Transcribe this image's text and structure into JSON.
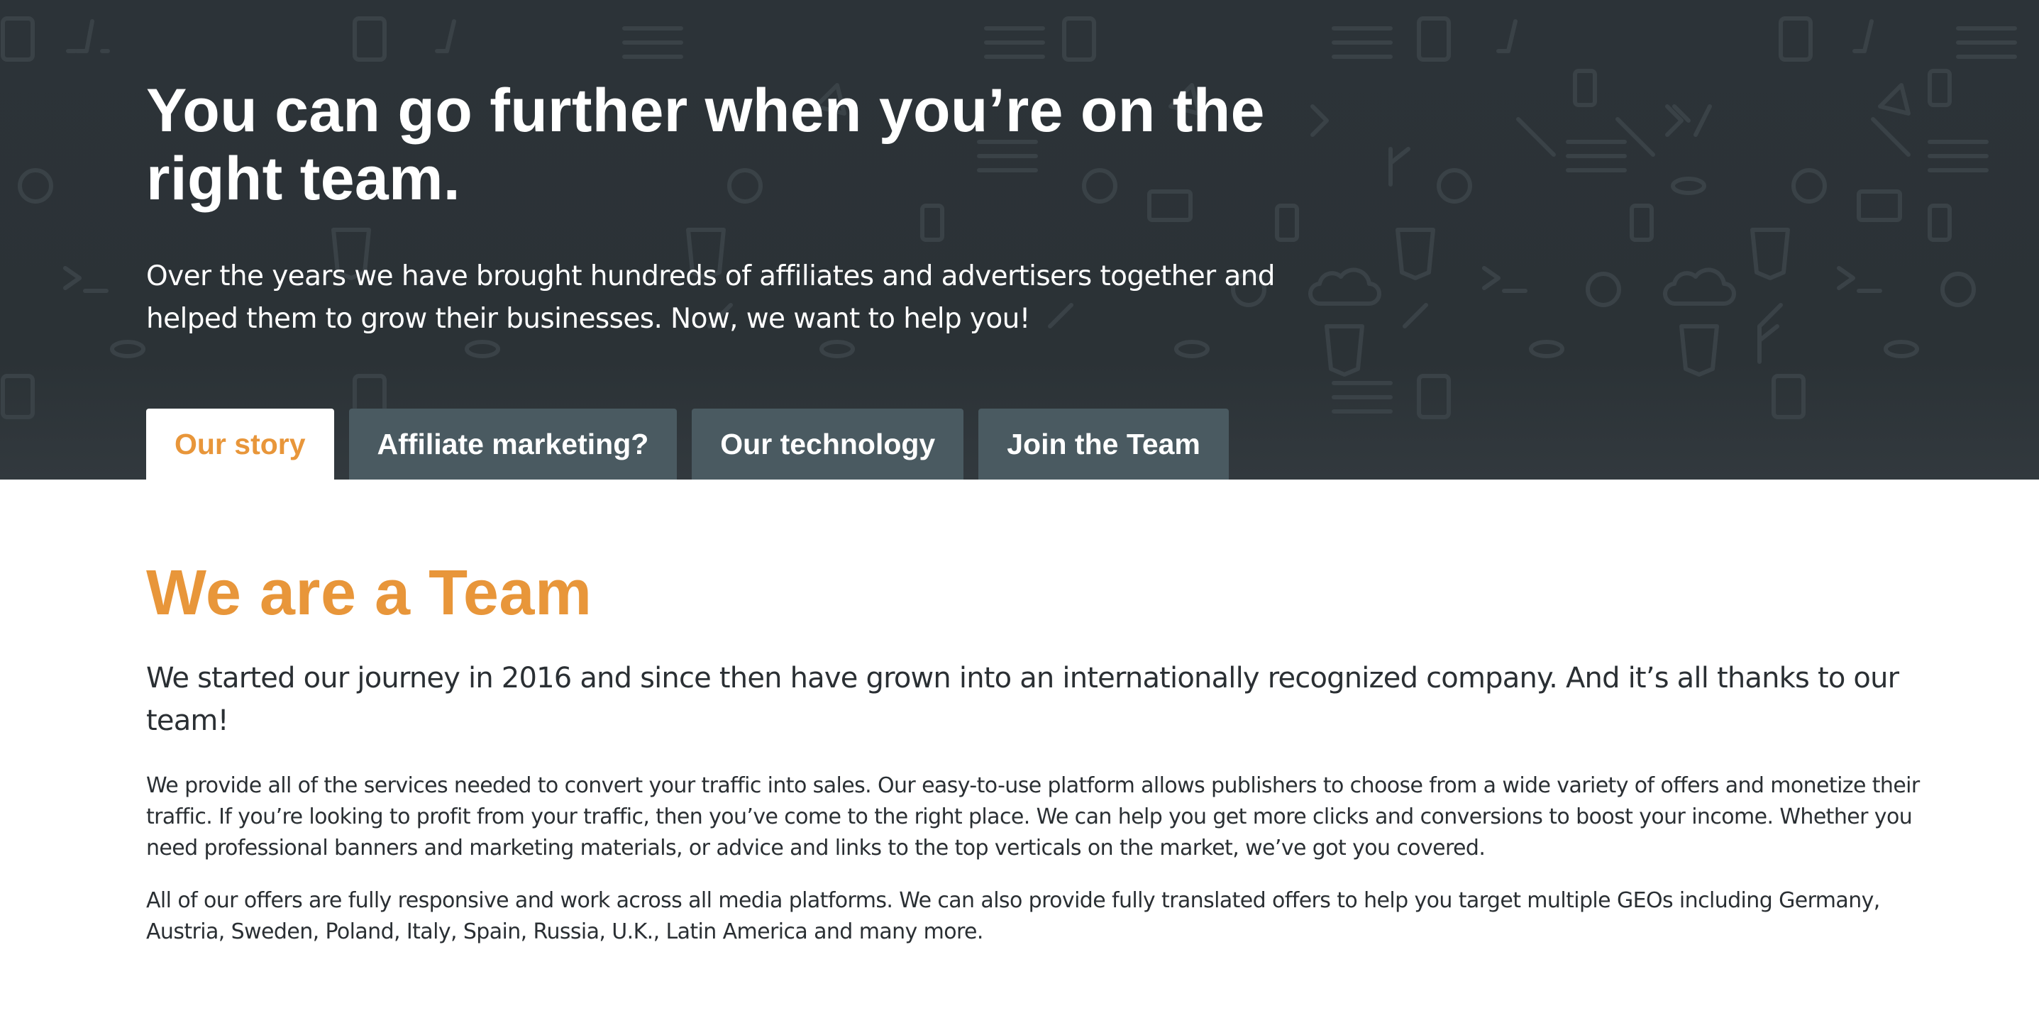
{
  "hero": {
    "title": "You can go further when you’re on the right team.",
    "subtitle": "Over the years we have brought hundreds of affiliates and advertisers together and helped them to grow their businesses. Now, we want to help you!"
  },
  "tabs": [
    {
      "label": "Our story",
      "active": true
    },
    {
      "label": "Affiliate marketing?",
      "active": false
    },
    {
      "label": "Our technology",
      "active": false
    },
    {
      "label": "Join the Team",
      "active": false
    }
  ],
  "content": {
    "title": "We are a Team",
    "lead": "We started our journey in 2016 and since then have grown into an internationally recognized company. And it’s all thanks to our team!",
    "paragraphs": [
      "We provide all of the services needed to convert your traffic into sales. Our easy-to-use platform allows publishers to choose from a wide variety of offers and monetize their traffic. If you’re looking to profit from your traffic, then you’ve come to the right place. We can help you get more clicks and conversions to boost your income. Whether you need professional banners and marketing materials, or advice and links to the top verticals on the market, we’ve got you covered.",
      "All of our offers are fully responsive and work across all media platforms. We can also provide fully translated offers to help you target multiple GEOs including Germany, Austria, Sweden, Poland, Italy, Spain, Russia, U.K., Latin America and many more."
    ]
  },
  "colors": {
    "hero_background": "#2c3338",
    "accent": "#e8963a",
    "tab_inactive": "#4a5a61",
    "body_text": "#2a2f33"
  },
  "background_icons": [
    "tablet-icon",
    "code-icon",
    "sliders-icon",
    "gear-icon",
    "database-icon",
    "html5-icon",
    "css3-icon",
    "link-icon",
    "terminal-icon",
    "git-branch-icon",
    "cloud-icon",
    "wrench-icon",
    "phone-icon",
    "monitor-icon",
    "rocket-icon"
  ]
}
